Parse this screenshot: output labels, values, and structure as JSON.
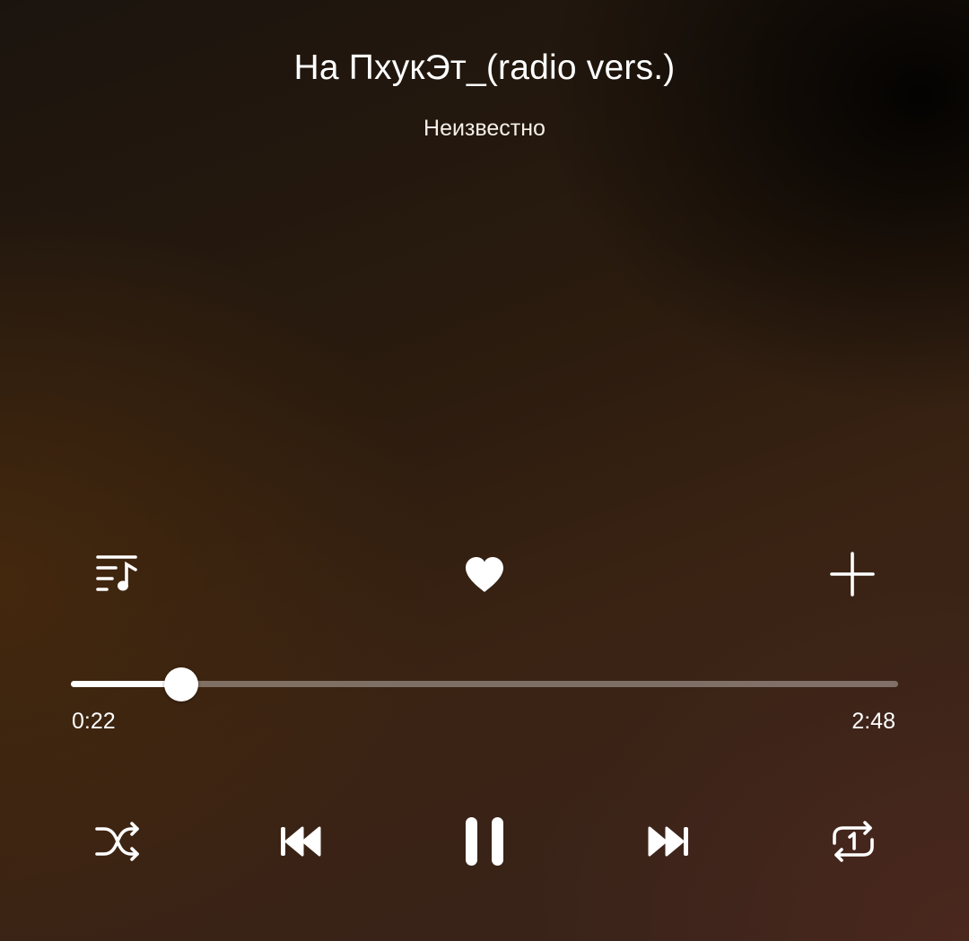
{
  "track": {
    "title": "На ПхукЭт_(radio vers.)",
    "artist": "Неизвестно"
  },
  "actions": {
    "queue_icon": "playlist-music-icon",
    "like_icon": "heart-filled-icon",
    "add_icon": "plus-icon"
  },
  "progress": {
    "elapsed": "0:22",
    "total": "2:48",
    "fraction": 0.133
  },
  "controls": {
    "shuffle_icon": "shuffle-icon",
    "previous_icon": "skip-previous-icon",
    "pause_icon": "pause-icon",
    "next_icon": "skip-next-icon",
    "repeat_icon": "repeat-one-icon"
  },
  "colors": {
    "foreground": "#ffffff",
    "track_unfilled": "rgba(255,255,255,0.35)",
    "background_dark": "#1b140e",
    "background_warm": "#3a2313"
  }
}
